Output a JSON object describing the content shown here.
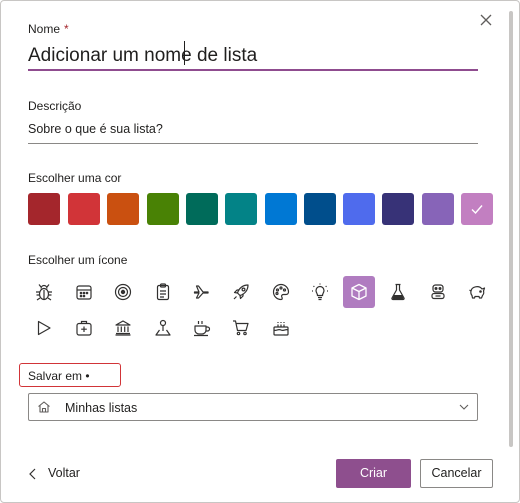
{
  "form": {
    "name_label": "Nome",
    "required_mark": "*",
    "name_value": "Adicionar um nome de lista",
    "description_label": "Descrição",
    "description_placeholder": "Sobre o que é sua lista?",
    "color_label": "Escolher uma cor",
    "icon_label": "Escolher um ícone",
    "save_label": "Salvar em •",
    "save_value": "Minhas listas"
  },
  "colors": [
    {
      "name": "dark-red",
      "hex": "#a4262c",
      "selected": false
    },
    {
      "name": "red",
      "hex": "#d13438",
      "selected": false
    },
    {
      "name": "orange",
      "hex": "#ca5010",
      "selected": false
    },
    {
      "name": "green",
      "hex": "#498205",
      "selected": false
    },
    {
      "name": "dark-teal",
      "hex": "#006b5a",
      "selected": false
    },
    {
      "name": "teal",
      "hex": "#038387",
      "selected": false
    },
    {
      "name": "blue",
      "hex": "#0078d4",
      "selected": false
    },
    {
      "name": "dark-blue",
      "hex": "#004e8c",
      "selected": false
    },
    {
      "name": "periwinkle",
      "hex": "#4f6bed",
      "selected": false
    },
    {
      "name": "indigo",
      "hex": "#373277",
      "selected": false
    },
    {
      "name": "purple",
      "hex": "#8764b8",
      "selected": false
    },
    {
      "name": "orchid",
      "hex": "#c27fc1",
      "selected": true
    }
  ],
  "icons": [
    "bug-icon",
    "calendar-icon",
    "target-icon",
    "clipboard-icon",
    "airplane-icon",
    "rocket-icon",
    "palette-icon",
    "lightbulb-icon",
    "cube-icon",
    "flask-icon",
    "robot-icon",
    "piggy-bank-icon",
    "play-icon",
    "first-aid-icon",
    "bank-icon",
    "map-pin-icon",
    "coffee-cup-icon",
    "shopping-cart-icon",
    "cake-icon"
  ],
  "selected_icon": "cube-icon",
  "accent": "#8e4f8e",
  "footer": {
    "back_label": "Voltar",
    "create_label": "Criar",
    "cancel_label": "Cancelar"
  }
}
